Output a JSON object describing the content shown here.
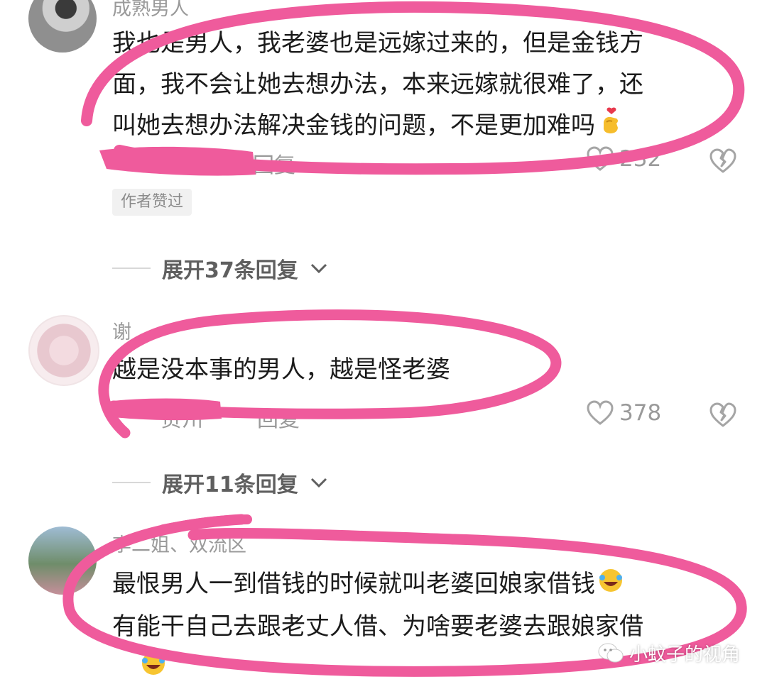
{
  "comments": [
    {
      "username": "成熟男人",
      "content_lines": [
        "我也是男人，我老婆也是远嫁过来的，但是金钱方",
        "面，我不会让她去想办法，本来远嫁就很难了，还",
        "叫她去想办法解决金钱的问题，不是更加难吗"
      ],
      "reply_label": "回复",
      "like_count": "232",
      "badge": "作者赞过",
      "expand_label": "展开37条回复"
    },
    {
      "username": "谢",
      "content_lines": [
        "越是没本事的男人，越是怪老婆"
      ],
      "meta_partial": "贵州",
      "reply_label": "回复",
      "like_count": "378",
      "expand_label": "展开11条回复"
    },
    {
      "username": "李二姐、双流区",
      "content_lines": [
        "最恨男人一到借钱的时候就叫老婆回娘家借钱",
        "有能干自己去跟老丈人借、为啥要老婆去跟娘家借"
      ]
    }
  ],
  "watermark": "小蚊子的视角",
  "icons": {
    "like": "heart-outline-icon",
    "dislike": "broken-heart-icon",
    "expand": "chevron-down-icon",
    "emoji_finger_heart": "finger-heart-emoji",
    "emoji_laugh": "laugh-cry-emoji",
    "watermark": "wechat-icon"
  },
  "colors": {
    "annotation": "#ef5b9c",
    "meta_gray": "#9a9a9a",
    "text": "#1b1b1b"
  }
}
